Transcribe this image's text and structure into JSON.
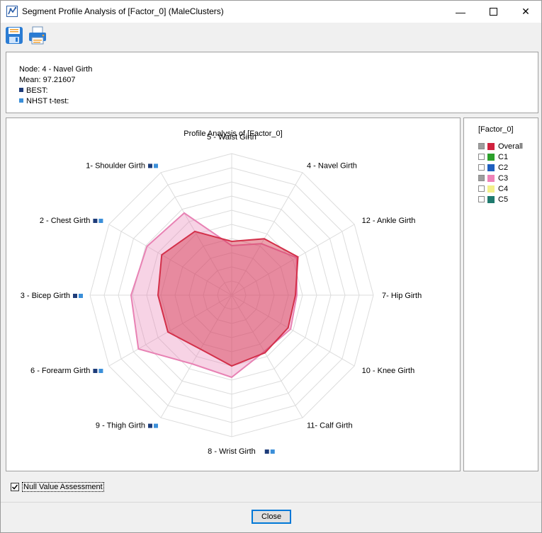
{
  "window": {
    "title": "Segment Profile Analysis of [Factor_0] (MaleClusters)",
    "controls": {
      "minimize": "—",
      "maximize": "☐",
      "close": "✕"
    }
  },
  "toolbar": {
    "icons": [
      "save-icon",
      "print-icon"
    ]
  },
  "info": {
    "node": "Node: 4 - Navel Girth",
    "mean": "Mean: 97.21607",
    "best": "BEST:",
    "nhst": "NHST t-test:",
    "best_color": "#1f3d7a",
    "nhst_color": "#3b8fd9"
  },
  "chart_data": {
    "type": "radar",
    "title": "Profile Analysis of [Factor_0]",
    "axes": [
      "5 - Waist Girth",
      "4 - Navel Girth",
      "12 - Ankle Girth",
      "7- Hip Girth",
      "10 - Knee Girth",
      "11- Calf Girth",
      "8 - Wrist Girth",
      "9 - Thigh Girth",
      "6 - Forearm Girth",
      "3 - Bicep Girth",
      "2 - Chest Girth",
      "1- Shoulder Girth"
    ],
    "axes_markers": [
      false,
      false,
      false,
      false,
      false,
      false,
      true,
      true,
      true,
      true,
      true,
      true
    ],
    "rings": 10,
    "range": [
      0,
      1
    ],
    "series": [
      {
        "name": "C3",
        "color": "#e882b4",
        "fill_opacity": 0.35,
        "values": [
          0.35,
          0.42,
          0.53,
          0.46,
          0.48,
          0.46,
          0.58,
          0.56,
          0.76,
          0.71,
          0.69,
          0.67
        ]
      },
      {
        "name": "Overall",
        "color": "#d3304a",
        "fill_opacity": 0.45,
        "values": [
          0.38,
          0.46,
          0.54,
          0.45,
          0.46,
          0.47,
          0.5,
          0.44,
          0.52,
          0.52,
          0.57,
          0.52
        ]
      }
    ]
  },
  "legend": {
    "title": "[Factor_0]",
    "items": [
      {
        "label": "Overall",
        "color": "#d0223e",
        "checked": true
      },
      {
        "label": "C1",
        "color": "#2ca02c",
        "checked": false
      },
      {
        "label": "C2",
        "color": "#1f5fbf",
        "checked": false
      },
      {
        "label": "C3",
        "color": "#ee82b8",
        "checked": true
      },
      {
        "label": "C4",
        "color": "#f3f08a",
        "checked": false
      },
      {
        "label": "C5",
        "color": "#1f7a6e",
        "checked": false
      }
    ]
  },
  "null_value": {
    "label": "Null Value Assessment",
    "checked": true
  },
  "footer": {
    "close_label": "Close"
  }
}
